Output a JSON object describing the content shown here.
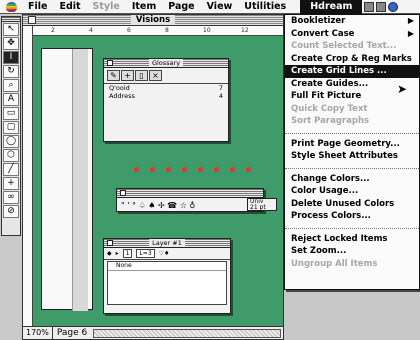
{
  "menubar": {
    "menus": [
      {
        "label": "File",
        "dim": false
      },
      {
        "label": "Edit",
        "dim": false
      },
      {
        "label": "Style",
        "dim": true
      },
      {
        "label": "Item",
        "dim": false
      },
      {
        "label": "Page",
        "dim": false
      },
      {
        "label": "View",
        "dim": false
      },
      {
        "label": "Utilities",
        "dim": false
      }
    ],
    "active_menu": "Hdream"
  },
  "document": {
    "title": "Visions",
    "zoom": "170%",
    "page": "Page 6",
    "ruler_ticks": [
      "2",
      "4",
      "6",
      "8",
      "10",
      "12"
    ]
  },
  "glossary": {
    "title": "Glossary",
    "entries": [
      {
        "name": "Q'ooid",
        "count": "7"
      },
      {
        "name": "Address",
        "count": "4"
      }
    ]
  },
  "measure": {
    "glyphs": "\" '  ° ♤ ♠ ✢ ☎ ☆ ♁",
    "side_text": "Univ",
    "side_num": "21 pt"
  },
  "layer": {
    "title": "Layer #1",
    "field1": "1",
    "field2": "L=3",
    "rows": [
      "None"
    ]
  },
  "dropdown": {
    "items": [
      {
        "label": "Bookletizer",
        "dim": false,
        "submenu": true
      },
      {
        "label": "Convert Case",
        "dim": false,
        "submenu": true
      },
      {
        "label": "Count Selected Text...",
        "dim": true
      },
      {
        "label": "Create Crop & Reg Marks",
        "dim": false
      },
      {
        "label": "Create Grid Lines ...",
        "dim": false,
        "highlight": true
      },
      {
        "label": "Create Guides...",
        "dim": false
      },
      {
        "label": "Full Fit Picture",
        "dim": false
      },
      {
        "label": "Quick Copy Text",
        "dim": true
      },
      {
        "label": "Sort Paragraphs",
        "dim": true
      },
      {
        "sep": true
      },
      {
        "label": "Print Page Geometry...",
        "dim": false
      },
      {
        "label": "Style Sheet Attributes",
        "dim": false
      },
      {
        "sep": true
      },
      {
        "label": "Change Colors...",
        "dim": false
      },
      {
        "label": "Color Usage...",
        "dim": false
      },
      {
        "label": "Delete Unused Colors",
        "dim": false
      },
      {
        "label": "Process Colors...",
        "dim": false
      },
      {
        "sep": true
      },
      {
        "label": "Reject Locked Items",
        "dim": false
      },
      {
        "label": "Set Zoom...",
        "dim": false
      },
      {
        "label": "Ungroup All Items",
        "dim": true
      }
    ]
  },
  "colors": {
    "pasteboard": "#3f9c6a",
    "marker": "#e3332a"
  },
  "tool_icons": [
    "arrow-icon",
    "move-icon",
    "text-icon",
    "rotate-icon",
    "zoom-icon",
    "textbox-icon",
    "rectbox-icon",
    "roundbox-icon",
    "ovalbox-icon",
    "polybox-icon",
    "line-icon",
    "ortholine-icon",
    "link-icon",
    "unlink-icon"
  ]
}
